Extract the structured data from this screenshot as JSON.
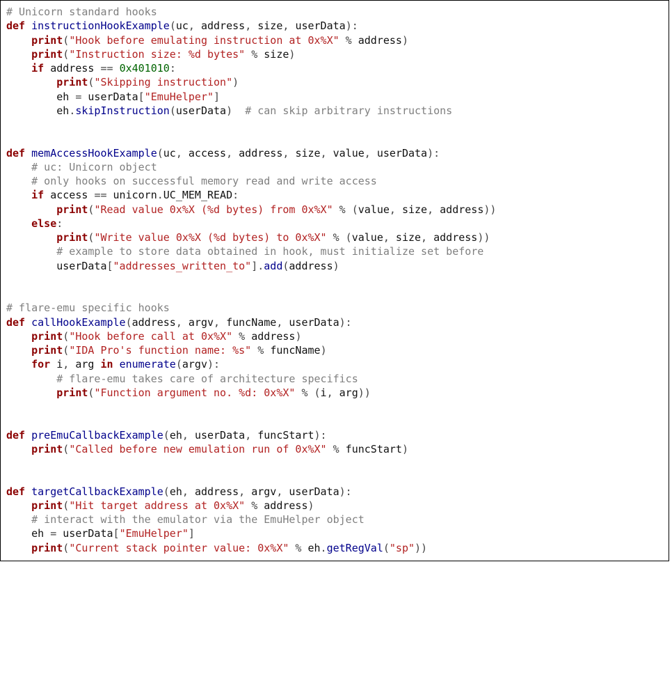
{
  "lines": [
    [
      {
        "c": "cmt",
        "t": "# Unicorn standard hooks"
      }
    ],
    [
      {
        "c": "kw",
        "t": "def"
      },
      {
        "c": "id",
        "t": " "
      },
      {
        "c": "fn",
        "t": "instructionHookExample"
      },
      {
        "c": "op",
        "t": "("
      },
      {
        "c": "id",
        "t": "uc"
      },
      {
        "c": "op",
        "t": ", "
      },
      {
        "c": "id",
        "t": "address"
      },
      {
        "c": "op",
        "t": ", "
      },
      {
        "c": "id",
        "t": "size"
      },
      {
        "c": "op",
        "t": ", "
      },
      {
        "c": "id",
        "t": "userData"
      },
      {
        "c": "op",
        "t": "):"
      }
    ],
    [
      {
        "c": "id",
        "t": "    "
      },
      {
        "c": "kw",
        "t": "print"
      },
      {
        "c": "op",
        "t": "("
      },
      {
        "c": "str",
        "t": "\"Hook before emulating instruction at 0x%X\""
      },
      {
        "c": "op",
        "t": " % "
      },
      {
        "c": "id",
        "t": "address"
      },
      {
        "c": "op",
        "t": ")"
      }
    ],
    [
      {
        "c": "id",
        "t": "    "
      },
      {
        "c": "kw",
        "t": "print"
      },
      {
        "c": "op",
        "t": "("
      },
      {
        "c": "str",
        "t": "\"Instruction size: %d bytes\""
      },
      {
        "c": "op",
        "t": " % "
      },
      {
        "c": "id",
        "t": "size"
      },
      {
        "c": "op",
        "t": ")"
      }
    ],
    [
      {
        "c": "id",
        "t": "    "
      },
      {
        "c": "kw",
        "t": "if"
      },
      {
        "c": "id",
        "t": " address "
      },
      {
        "c": "op",
        "t": "== "
      },
      {
        "c": "num",
        "t": "0x401010"
      },
      {
        "c": "op",
        "t": ":"
      }
    ],
    [
      {
        "c": "id",
        "t": "        "
      },
      {
        "c": "kw",
        "t": "print"
      },
      {
        "c": "op",
        "t": "("
      },
      {
        "c": "str",
        "t": "\"Skipping instruction\""
      },
      {
        "c": "op",
        "t": ")"
      }
    ],
    [
      {
        "c": "id",
        "t": "        eh "
      },
      {
        "c": "op",
        "t": "= "
      },
      {
        "c": "id",
        "t": "userData"
      },
      {
        "c": "op",
        "t": "["
      },
      {
        "c": "str",
        "t": "\"EmuHelper\""
      },
      {
        "c": "op",
        "t": "]"
      }
    ],
    [
      {
        "c": "id",
        "t": "        eh"
      },
      {
        "c": "op",
        "t": "."
      },
      {
        "c": "fn",
        "t": "skipInstruction"
      },
      {
        "c": "op",
        "t": "("
      },
      {
        "c": "id",
        "t": "userData"
      },
      {
        "c": "op",
        "t": ")  "
      },
      {
        "c": "cmt",
        "t": "# can skip arbitrary instructions"
      }
    ],
    [
      {
        "c": "id",
        "t": ""
      }
    ],
    [
      {
        "c": "id",
        "t": ""
      }
    ],
    [
      {
        "c": "kw",
        "t": "def"
      },
      {
        "c": "id",
        "t": " "
      },
      {
        "c": "fn",
        "t": "memAccessHookExample"
      },
      {
        "c": "op",
        "t": "("
      },
      {
        "c": "id",
        "t": "uc"
      },
      {
        "c": "op",
        "t": ", "
      },
      {
        "c": "id",
        "t": "access"
      },
      {
        "c": "op",
        "t": ", "
      },
      {
        "c": "id",
        "t": "address"
      },
      {
        "c": "op",
        "t": ", "
      },
      {
        "c": "id",
        "t": "size"
      },
      {
        "c": "op",
        "t": ", "
      },
      {
        "c": "id",
        "t": "value"
      },
      {
        "c": "op",
        "t": ", "
      },
      {
        "c": "id",
        "t": "userData"
      },
      {
        "c": "op",
        "t": "):"
      }
    ],
    [
      {
        "c": "id",
        "t": "    "
      },
      {
        "c": "cmt",
        "t": "# uc: Unicorn object"
      }
    ],
    [
      {
        "c": "id",
        "t": "    "
      },
      {
        "c": "cmt",
        "t": "# only hooks on successful memory read and write access"
      }
    ],
    [
      {
        "c": "id",
        "t": "    "
      },
      {
        "c": "kw",
        "t": "if"
      },
      {
        "c": "id",
        "t": " access "
      },
      {
        "c": "op",
        "t": "== "
      },
      {
        "c": "id",
        "t": "unicorn"
      },
      {
        "c": "op",
        "t": "."
      },
      {
        "c": "id",
        "t": "UC_MEM_READ"
      },
      {
        "c": "op",
        "t": ":"
      }
    ],
    [
      {
        "c": "id",
        "t": "        "
      },
      {
        "c": "kw",
        "t": "print"
      },
      {
        "c": "op",
        "t": "("
      },
      {
        "c": "str",
        "t": "\"Read value 0x%X (%d bytes) from 0x%X\""
      },
      {
        "c": "op",
        "t": " % ("
      },
      {
        "c": "id",
        "t": "value"
      },
      {
        "c": "op",
        "t": ", "
      },
      {
        "c": "id",
        "t": "size"
      },
      {
        "c": "op",
        "t": ", "
      },
      {
        "c": "id",
        "t": "address"
      },
      {
        "c": "op",
        "t": "))"
      }
    ],
    [
      {
        "c": "id",
        "t": "    "
      },
      {
        "c": "kw",
        "t": "else"
      },
      {
        "c": "op",
        "t": ":"
      }
    ],
    [
      {
        "c": "id",
        "t": "        "
      },
      {
        "c": "kw",
        "t": "print"
      },
      {
        "c": "op",
        "t": "("
      },
      {
        "c": "str",
        "t": "\"Write value 0x%X (%d bytes) to 0x%X\""
      },
      {
        "c": "op",
        "t": " % ("
      },
      {
        "c": "id",
        "t": "value"
      },
      {
        "c": "op",
        "t": ", "
      },
      {
        "c": "id",
        "t": "size"
      },
      {
        "c": "op",
        "t": ", "
      },
      {
        "c": "id",
        "t": "address"
      },
      {
        "c": "op",
        "t": "))"
      }
    ],
    [
      {
        "c": "id",
        "t": "        "
      },
      {
        "c": "cmt",
        "t": "# example to store data obtained in hook, must initialize set before"
      }
    ],
    [
      {
        "c": "id",
        "t": "        userData"
      },
      {
        "c": "op",
        "t": "["
      },
      {
        "c": "str",
        "t": "\"addresses_written_to\""
      },
      {
        "c": "op",
        "t": "]."
      },
      {
        "c": "fn",
        "t": "add"
      },
      {
        "c": "op",
        "t": "("
      },
      {
        "c": "id",
        "t": "address"
      },
      {
        "c": "op",
        "t": ")"
      }
    ],
    [
      {
        "c": "id",
        "t": ""
      }
    ],
    [
      {
        "c": "id",
        "t": ""
      }
    ],
    [
      {
        "c": "cmt",
        "t": "# flare-emu specific hooks"
      }
    ],
    [
      {
        "c": "kw",
        "t": "def"
      },
      {
        "c": "id",
        "t": " "
      },
      {
        "c": "fn",
        "t": "callHookExample"
      },
      {
        "c": "op",
        "t": "("
      },
      {
        "c": "id",
        "t": "address"
      },
      {
        "c": "op",
        "t": ", "
      },
      {
        "c": "id",
        "t": "argv"
      },
      {
        "c": "op",
        "t": ", "
      },
      {
        "c": "id",
        "t": "funcName"
      },
      {
        "c": "op",
        "t": ", "
      },
      {
        "c": "id",
        "t": "userData"
      },
      {
        "c": "op",
        "t": "):"
      }
    ],
    [
      {
        "c": "id",
        "t": "    "
      },
      {
        "c": "kw",
        "t": "print"
      },
      {
        "c": "op",
        "t": "("
      },
      {
        "c": "str",
        "t": "\"Hook before call at 0x%X\""
      },
      {
        "c": "op",
        "t": " % "
      },
      {
        "c": "id",
        "t": "address"
      },
      {
        "c": "op",
        "t": ")"
      }
    ],
    [
      {
        "c": "id",
        "t": "    "
      },
      {
        "c": "kw",
        "t": "print"
      },
      {
        "c": "op",
        "t": "("
      },
      {
        "c": "str",
        "t": "\"IDA Pro's function name: %s\""
      },
      {
        "c": "op",
        "t": " % "
      },
      {
        "c": "id",
        "t": "funcName"
      },
      {
        "c": "op",
        "t": ")"
      }
    ],
    [
      {
        "c": "id",
        "t": "    "
      },
      {
        "c": "kw",
        "t": "for"
      },
      {
        "c": "id",
        "t": " i"
      },
      {
        "c": "op",
        "t": ", "
      },
      {
        "c": "id",
        "t": "arg "
      },
      {
        "c": "kw",
        "t": "in"
      },
      {
        "c": "id",
        "t": " "
      },
      {
        "c": "fn",
        "t": "enumerate"
      },
      {
        "c": "op",
        "t": "("
      },
      {
        "c": "id",
        "t": "argv"
      },
      {
        "c": "op",
        "t": "):"
      }
    ],
    [
      {
        "c": "id",
        "t": "        "
      },
      {
        "c": "cmt",
        "t": "# flare-emu takes care of architecture specifics"
      }
    ],
    [
      {
        "c": "id",
        "t": "        "
      },
      {
        "c": "kw",
        "t": "print"
      },
      {
        "c": "op",
        "t": "("
      },
      {
        "c": "str",
        "t": "\"Function argument no. %d: 0x%X\""
      },
      {
        "c": "op",
        "t": " % ("
      },
      {
        "c": "id",
        "t": "i"
      },
      {
        "c": "op",
        "t": ", "
      },
      {
        "c": "id",
        "t": "arg"
      },
      {
        "c": "op",
        "t": "))"
      }
    ],
    [
      {
        "c": "id",
        "t": ""
      }
    ],
    [
      {
        "c": "id",
        "t": ""
      }
    ],
    [
      {
        "c": "kw",
        "t": "def"
      },
      {
        "c": "id",
        "t": " "
      },
      {
        "c": "fn",
        "t": "preEmuCallbackExample"
      },
      {
        "c": "op",
        "t": "("
      },
      {
        "c": "id",
        "t": "eh"
      },
      {
        "c": "op",
        "t": ", "
      },
      {
        "c": "id",
        "t": "userData"
      },
      {
        "c": "op",
        "t": ", "
      },
      {
        "c": "id",
        "t": "funcStart"
      },
      {
        "c": "op",
        "t": "):"
      }
    ],
    [
      {
        "c": "id",
        "t": "    "
      },
      {
        "c": "kw",
        "t": "print"
      },
      {
        "c": "op",
        "t": "("
      },
      {
        "c": "str",
        "t": "\"Called before new emulation run of 0x%X\""
      },
      {
        "c": "op",
        "t": " % "
      },
      {
        "c": "id",
        "t": "funcStart"
      },
      {
        "c": "op",
        "t": ")"
      }
    ],
    [
      {
        "c": "id",
        "t": ""
      }
    ],
    [
      {
        "c": "id",
        "t": ""
      }
    ],
    [
      {
        "c": "kw",
        "t": "def"
      },
      {
        "c": "id",
        "t": " "
      },
      {
        "c": "fn",
        "t": "targetCallbackExample"
      },
      {
        "c": "op",
        "t": "("
      },
      {
        "c": "id",
        "t": "eh"
      },
      {
        "c": "op",
        "t": ", "
      },
      {
        "c": "id",
        "t": "address"
      },
      {
        "c": "op",
        "t": ", "
      },
      {
        "c": "id",
        "t": "argv"
      },
      {
        "c": "op",
        "t": ", "
      },
      {
        "c": "id",
        "t": "userData"
      },
      {
        "c": "op",
        "t": "):"
      }
    ],
    [
      {
        "c": "id",
        "t": "    "
      },
      {
        "c": "kw",
        "t": "print"
      },
      {
        "c": "op",
        "t": "("
      },
      {
        "c": "str",
        "t": "\"Hit target address at 0x%X\""
      },
      {
        "c": "op",
        "t": " % "
      },
      {
        "c": "id",
        "t": "address"
      },
      {
        "c": "op",
        "t": ")"
      }
    ],
    [
      {
        "c": "id",
        "t": "    "
      },
      {
        "c": "cmt",
        "t": "# interact with the emulator via the EmuHelper object"
      }
    ],
    [
      {
        "c": "id",
        "t": "    eh "
      },
      {
        "c": "op",
        "t": "= "
      },
      {
        "c": "id",
        "t": "userData"
      },
      {
        "c": "op",
        "t": "["
      },
      {
        "c": "str",
        "t": "\"EmuHelper\""
      },
      {
        "c": "op",
        "t": "]"
      }
    ],
    [
      {
        "c": "id",
        "t": "    "
      },
      {
        "c": "kw",
        "t": "print"
      },
      {
        "c": "op",
        "t": "("
      },
      {
        "c": "str",
        "t": "\"Current stack pointer value: 0x%X\""
      },
      {
        "c": "op",
        "t": " % "
      },
      {
        "c": "id",
        "t": "eh"
      },
      {
        "c": "op",
        "t": "."
      },
      {
        "c": "fn",
        "t": "getRegVal"
      },
      {
        "c": "op",
        "t": "("
      },
      {
        "c": "str",
        "t": "\"sp\""
      },
      {
        "c": "op",
        "t": "))"
      }
    ]
  ]
}
